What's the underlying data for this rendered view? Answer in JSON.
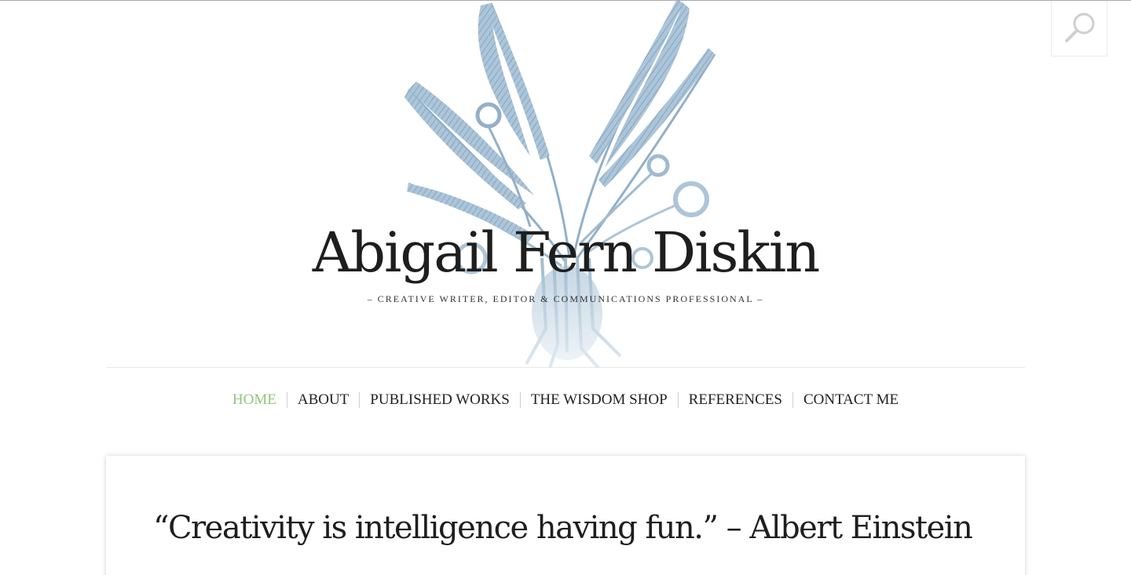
{
  "site": {
    "title": "Abigail Fern Diskin",
    "tagline": "– CREATIVE WRITER, EDITOR & COMMUNICATIONS PROFESSIONAL –"
  },
  "header": {
    "search_icon": "search-icon",
    "fern_image": "fern-illustration"
  },
  "nav": {
    "items": [
      {
        "label": "HOME",
        "active": true
      },
      {
        "label": "ABOUT",
        "active": false
      },
      {
        "label": "PUBLISHED WORKS",
        "active": false
      },
      {
        "label": "THE WISDOM SHOP",
        "active": false
      },
      {
        "label": "REFERENCES",
        "active": false
      },
      {
        "label": "CONTACT ME",
        "active": false
      }
    ]
  },
  "post": {
    "title": "“Creativity is intelligence having fun.” – Albert Einstein"
  },
  "colors": {
    "accent": "#8fc57d",
    "fern": "#7fa3bf",
    "text": "#1e1e1e"
  }
}
